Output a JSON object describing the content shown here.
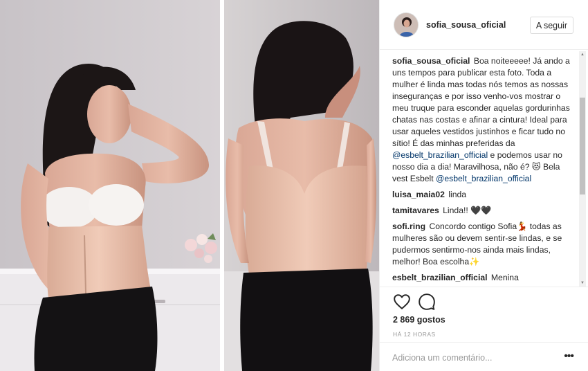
{
  "post": {
    "username": "sofia_sousa_oficial",
    "follow_label": "A seguir",
    "likes_text": "2 869 gostos",
    "time_text": "HÁ 12 HORAS"
  },
  "caption": {
    "user": "sofia_sousa_oficial",
    "text1": "Boa noiteeeee! Já ando a uns tempos para publicar esta foto. Toda a mulher é linda mas todas nós temos as nossas inseguranças e por isso venho-vos mostrar o meu truque para esconder aquelas gordurinhas chatas nas costas e afinar a cintura! Ideal para usar aqueles vestidos justinhos e ficar tudo no sítio! É das minhas preferidas da ",
    "mention1": "@esbelt_brazilian_official",
    "text2": " e podemos usar no nosso dia a dia! Maravilhosa, não é? 😻 Bela vest Esbelt ",
    "mention2": "@esbelt_brazilian_official"
  },
  "comments": [
    {
      "user": "luisa_maia02",
      "text": "linda"
    },
    {
      "user": "tamitavares",
      "text": "Linda!! 🖤🖤"
    },
    {
      "user": "sofi.ring",
      "text": "Concordo contigo Sofia💃 todas as mulheres são ou devem sentir-se lindas, e se pudermos sentirmo-nos ainda mais lindas, melhor! Boa escolha✨"
    },
    {
      "user": "esbelt_brazilian_official",
      "text": "Menina"
    }
  ],
  "add_comment": {
    "placeholder": "Adiciona um comentário...",
    "more_label": "•••"
  },
  "icons": {
    "like": "heart-icon",
    "comment": "speech-bubble-icon",
    "more": "more-options-icon"
  },
  "colors": {
    "mention": "#003569",
    "meta": "#999999",
    "border": "#efefef"
  }
}
